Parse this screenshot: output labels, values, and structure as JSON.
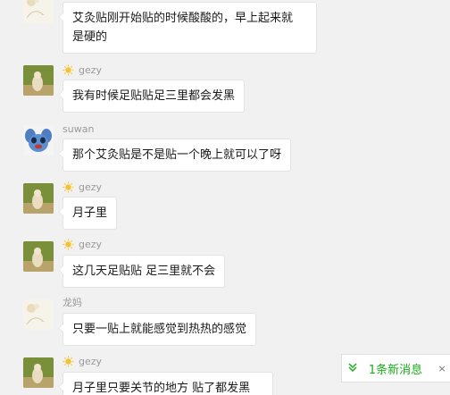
{
  "messages": [
    {
      "sender": "",
      "avatar_icon": "flower-avatar-icon",
      "has_badge": false,
      "lines": [
        "艾灸贴刚开始贴的时候酸酸的，早上起来就",
        "是硬的"
      ]
    },
    {
      "sender": "gezy",
      "avatar_icon": "dog-avatar-icon",
      "has_badge": true,
      "lines": [
        "我有时候足贴贴足三里都会发黑"
      ]
    },
    {
      "sender": "suwan",
      "avatar_icon": "stitch-avatar-icon",
      "has_badge": false,
      "lines": [
        "那个艾灸贴是不是贴一个晚上就可以了呀"
      ]
    },
    {
      "sender": "gezy",
      "avatar_icon": "dog-avatar-icon",
      "has_badge": true,
      "lines": [
        "月子里"
      ]
    },
    {
      "sender": "gezy",
      "avatar_icon": "dog-avatar-icon",
      "has_badge": true,
      "lines": [
        "这几天足贴贴 足三里就不会"
      ]
    },
    {
      "sender": "龙妈",
      "avatar_icon": "flower-avatar-icon",
      "has_badge": false,
      "lines": [
        "只要一贴上就能感觉到热热的感觉"
      ]
    },
    {
      "sender": "gezy",
      "avatar_icon": "dog-avatar-icon",
      "has_badge": true,
      "lines": [
        "月子里只要关节的地方 贴了都发黑"
      ]
    }
  ],
  "new_message_bar": {
    "chevron_icon": "double-chevron-down-icon",
    "label": "1条新消息",
    "close_icon": "close-icon",
    "close_glyph": "×"
  },
  "colors": {
    "background": "#f1f1f1",
    "bubble": "#ffffff",
    "sender_name": "#9a9a9a",
    "new_message": "#1aad19"
  }
}
